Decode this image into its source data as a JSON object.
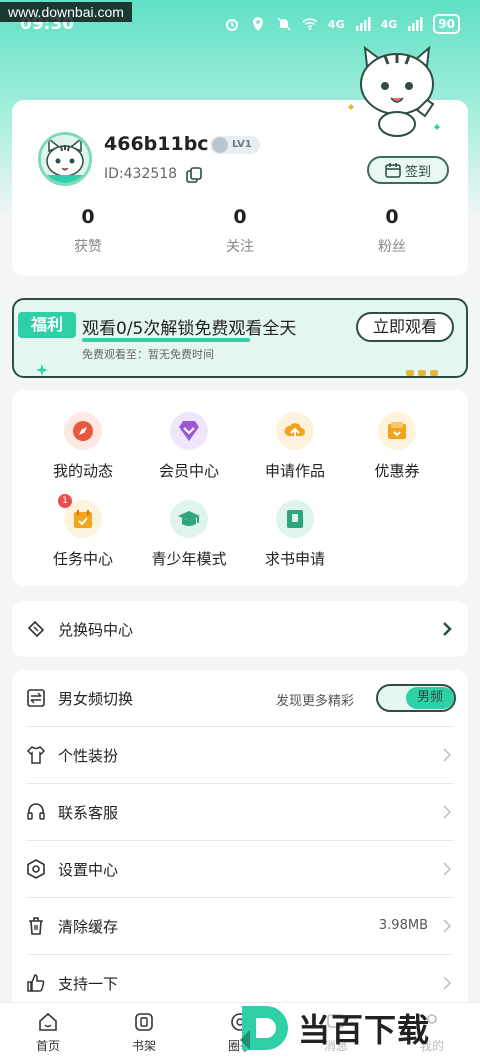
{
  "status_bar": {
    "time": "09:30",
    "network_1": "4G",
    "network_2": "4G",
    "battery": "90"
  },
  "watermark": "www.downbai.com",
  "profile": {
    "username": "466b11bc",
    "level": "LV1",
    "user_id": "ID:432518",
    "checkin_label": "签到",
    "stats": [
      {
        "value": "0",
        "label": "获赞"
      },
      {
        "value": "0",
        "label": "关注"
      },
      {
        "value": "0",
        "label": "粉丝"
      }
    ]
  },
  "promo": {
    "tag": "福利",
    "title": "观看0/5次解锁免费观看全天",
    "subtitle": "免费观看至：暂无免费时间",
    "button": "立即观看"
  },
  "grid": [
    {
      "label": "我的动态",
      "icon": "compass-icon",
      "bg": "#fde8e4",
      "color": "#e9573f"
    },
    {
      "label": "会员中心",
      "icon": "diamond-icon",
      "bg": "#efe6fb",
      "color": "#9b59d6"
    },
    {
      "label": "申请作品",
      "icon": "upload-cloud-icon",
      "bg": "#fff2dc",
      "color": "#f2a41c"
    },
    {
      "label": "优惠券",
      "icon": "coupon-icon",
      "bg": "#fff2dc",
      "color": "#f2a41c"
    },
    {
      "label": "任务中心",
      "icon": "task-calendar-icon",
      "bg": "#fff2dc",
      "color": "#f2a41c",
      "badge": "1"
    },
    {
      "label": "青少年模式",
      "icon": "graduation-cap-icon",
      "bg": "#dff5ec",
      "color": "#2fa57c"
    },
    {
      "label": "求书申请",
      "icon": "book-request-icon",
      "bg": "#dff5ec",
      "color": "#2fa57c"
    }
  ],
  "redeem": {
    "label": "兑换码中心"
  },
  "settings": {
    "gender_switch": {
      "label": "男女频切换",
      "hint": "发现更多精彩",
      "value": "男频"
    },
    "items": [
      {
        "label": "个性装扮"
      },
      {
        "label": "联系客服"
      },
      {
        "label": "设置中心"
      },
      {
        "label": "清除缓存",
        "value": "3.98MB"
      },
      {
        "label": "支持一下"
      }
    ]
  },
  "bottom_nav": [
    {
      "label": "首页",
      "icon": "home-icon"
    },
    {
      "label": "书架",
      "icon": "bookshelf-icon"
    },
    {
      "label": "圈子",
      "icon": "circle-icon"
    },
    {
      "label": "消息",
      "icon": "message-icon"
    },
    {
      "label": "我的",
      "icon": "profile-icon"
    }
  ],
  "logo_text": "当百下载",
  "colors": {
    "accent": "#2fcfa7",
    "dark_outline": "#2e4d44"
  }
}
